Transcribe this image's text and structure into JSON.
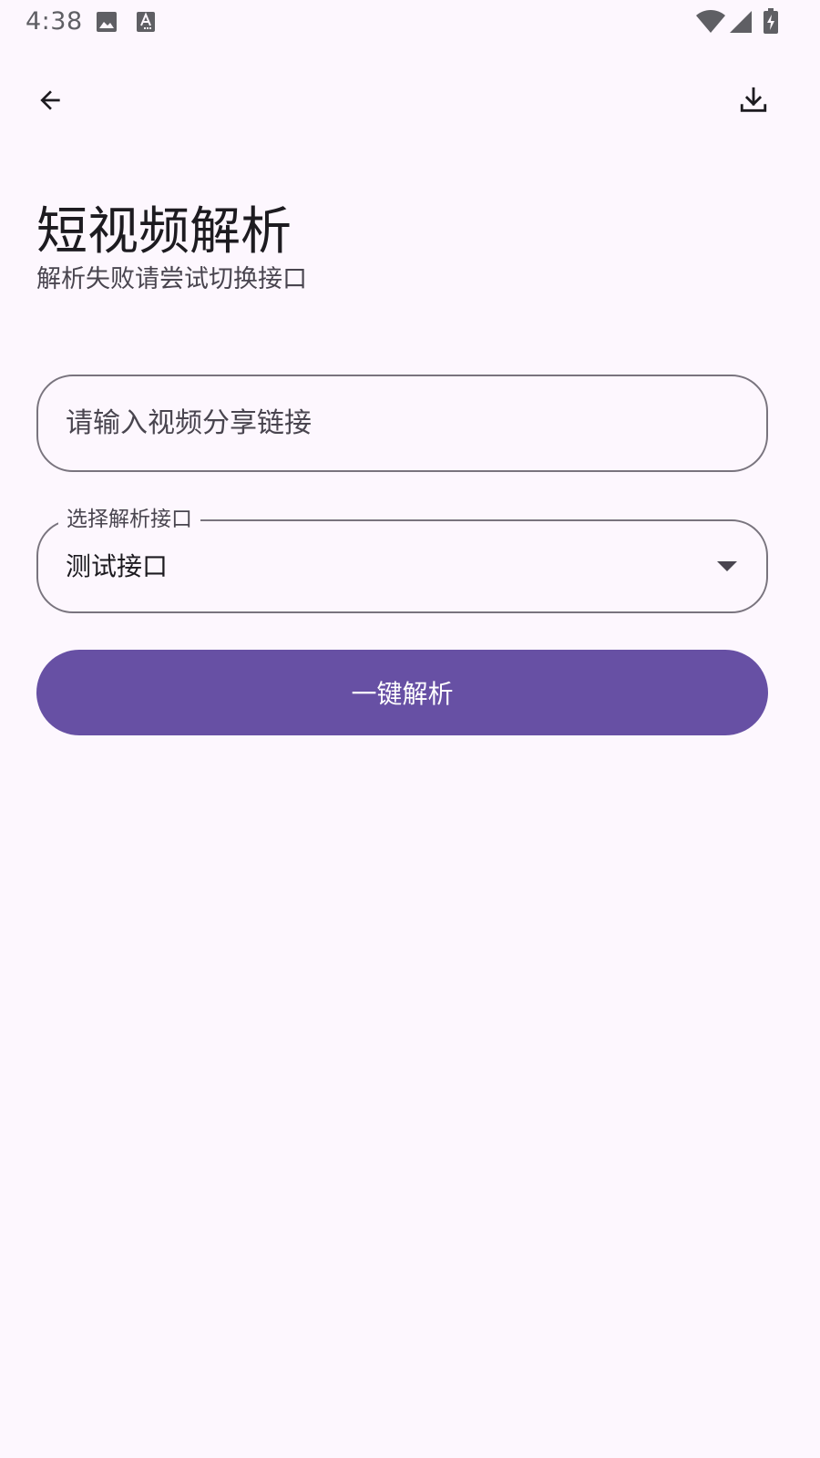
{
  "status_bar": {
    "time": "4:38",
    "icons": [
      "image-icon",
      "text-a-icon",
      "wifi-icon",
      "cellular-signal-icon",
      "battery-charging-icon"
    ]
  },
  "top_bar": {
    "back_icon": "arrow-back-icon",
    "download_icon": "download-icon"
  },
  "header": {
    "title": "短视频解析",
    "subtitle": "解析失败请尝试切换接口"
  },
  "form": {
    "url_input": {
      "placeholder": "请输入视频分享链接",
      "value": ""
    },
    "api_select": {
      "label": "选择解析接口",
      "selected": "测试接口"
    },
    "parse_button_label": "一键解析"
  },
  "colors": {
    "background": "#fdf7fe",
    "primary": "#6750a4",
    "outline": "#79747e",
    "on_surface": "#1d1b20",
    "on_surface_variant": "#49454f"
  }
}
